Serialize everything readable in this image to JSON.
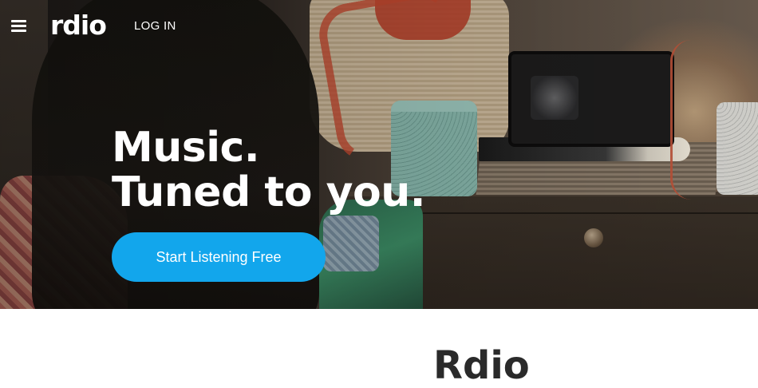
{
  "nav": {
    "logo_text": "rdio",
    "login_label": "LOG IN"
  },
  "hero": {
    "headline_line1": "Music.",
    "headline_line2": "Tuned to you.",
    "cta_label": "Start Listening Free"
  },
  "section": {
    "heading_partial": "Rdio"
  },
  "colors": {
    "cta_background": "#12a6ec",
    "text_light": "#ffffff",
    "text_dark": "#2a2a2a"
  },
  "icons": {
    "menu": "hamburger-menu-icon"
  }
}
